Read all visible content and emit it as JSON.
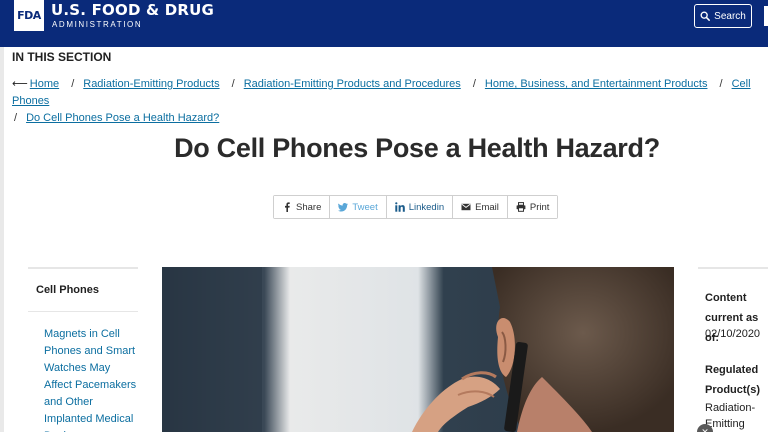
{
  "header": {
    "logo_text": "FDA",
    "agency_title": "U.S. FOOD & DRUG",
    "agency_subtitle": "ADMINISTRATION",
    "search_label": "Search",
    "brand_color": "#0a2a7a"
  },
  "section": {
    "label": "IN THIS SECTION"
  },
  "breadcrumb": {
    "items": [
      "Home",
      "Radiation-Emitting Products",
      "Radiation-Emitting Products and Procedures",
      "Home, Business, and Entertainment Products",
      "Cell Phones",
      "Do Cell Phones Pose a Health Hazard?"
    ]
  },
  "page": {
    "title": "Do Cell Phones Pose a Health Hazard?"
  },
  "share": {
    "share": "Share",
    "tweet": "Tweet",
    "linkedin": "Linkedin",
    "email": "Email",
    "print": "Print"
  },
  "sidebar": {
    "heading": "Cell Phones",
    "link_text": "Magnets in Cell Phones and Smart Watches May Affect Pacemakers and Other Implanted Medical Devices"
  },
  "meta": {
    "content_current_label": "Content current as of:",
    "content_date": "02/10/2020",
    "regulated_label": "Regulated Product(s)",
    "regulated_value": "Radiation-Emitting Products"
  },
  "icons": {
    "logo": "fda-logo",
    "search": "search-icon",
    "back": "back-arrow-icon",
    "share": "facebook-icon",
    "tweet": "twitter-icon",
    "linkedin": "linkedin-icon",
    "email": "envelope-icon",
    "print": "printer-icon",
    "dismiss": "close-icon"
  }
}
